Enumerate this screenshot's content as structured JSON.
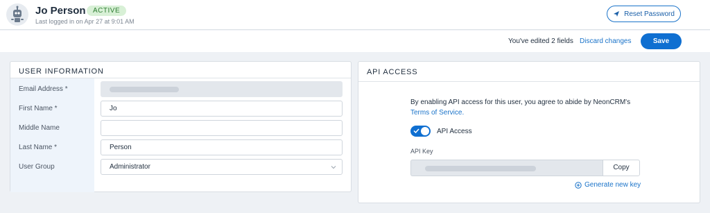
{
  "header": {
    "user_name": "Jo Person",
    "status": "ACTIVE",
    "last_login": "Last logged in on Apr 27 at 9:01 AM",
    "reset_password_label": "Reset Password"
  },
  "actionbar": {
    "edited_text": "You've edited 2 fields",
    "discard_label": "Discard changes",
    "save_label": "Save"
  },
  "user_info": {
    "title": "USER INFORMATION",
    "fields": [
      {
        "label": "Email Address *",
        "value": ""
      },
      {
        "label": "First Name *",
        "value": "Jo"
      },
      {
        "label": "Middle Name",
        "value": ""
      },
      {
        "label": "Last Name *",
        "value": "Person"
      },
      {
        "label": "User Group",
        "value": "Administrator"
      }
    ]
  },
  "api_access": {
    "title": "API ACCESS",
    "agreement_text": "By enabling API access for this user, you agree to abide by NeonCRM's",
    "tos_link": "Terms of Service.",
    "toggle_label": "API Access",
    "toggle_on": true,
    "api_key_label": "API Key",
    "copy_label": "Copy",
    "generate_label": "Generate new key"
  },
  "colors": {
    "accent": "#0f6fd1",
    "link": "#1a73c9",
    "status_bg": "#d8f0d6",
    "status_text": "#2e7d32"
  },
  "icons": {
    "avatar": "robot-avatar-icon",
    "reset": "paper-plane-icon",
    "select": "chevron-down-icon",
    "toggle_check": "check-icon",
    "generate": "plus-circle-icon"
  }
}
